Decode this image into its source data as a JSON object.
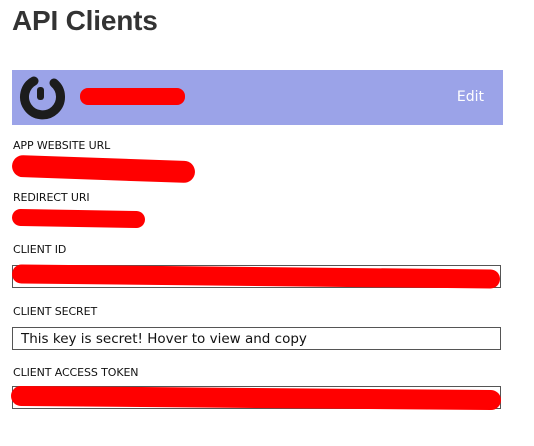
{
  "page": {
    "title": "API Clients"
  },
  "app_header": {
    "background_color": "#9ba3e8",
    "logo_icon": "app-logo-icon",
    "name": "",
    "edit_label": "Edit"
  },
  "fields": {
    "app_website_url": {
      "label": "APP WEBSITE URL",
      "value": ""
    },
    "redirect_uri": {
      "label": "REDIRECT URI",
      "value": ""
    },
    "client_id": {
      "label": "CLIENT ID",
      "value": ""
    },
    "client_secret": {
      "label": "CLIENT SECRET",
      "placeholder_text": "This key is secret! Hover to view and copy"
    },
    "client_access_token": {
      "label": "CLIENT ACCESS TOKEN",
      "value": ""
    }
  },
  "redaction_color": "#ff0000"
}
